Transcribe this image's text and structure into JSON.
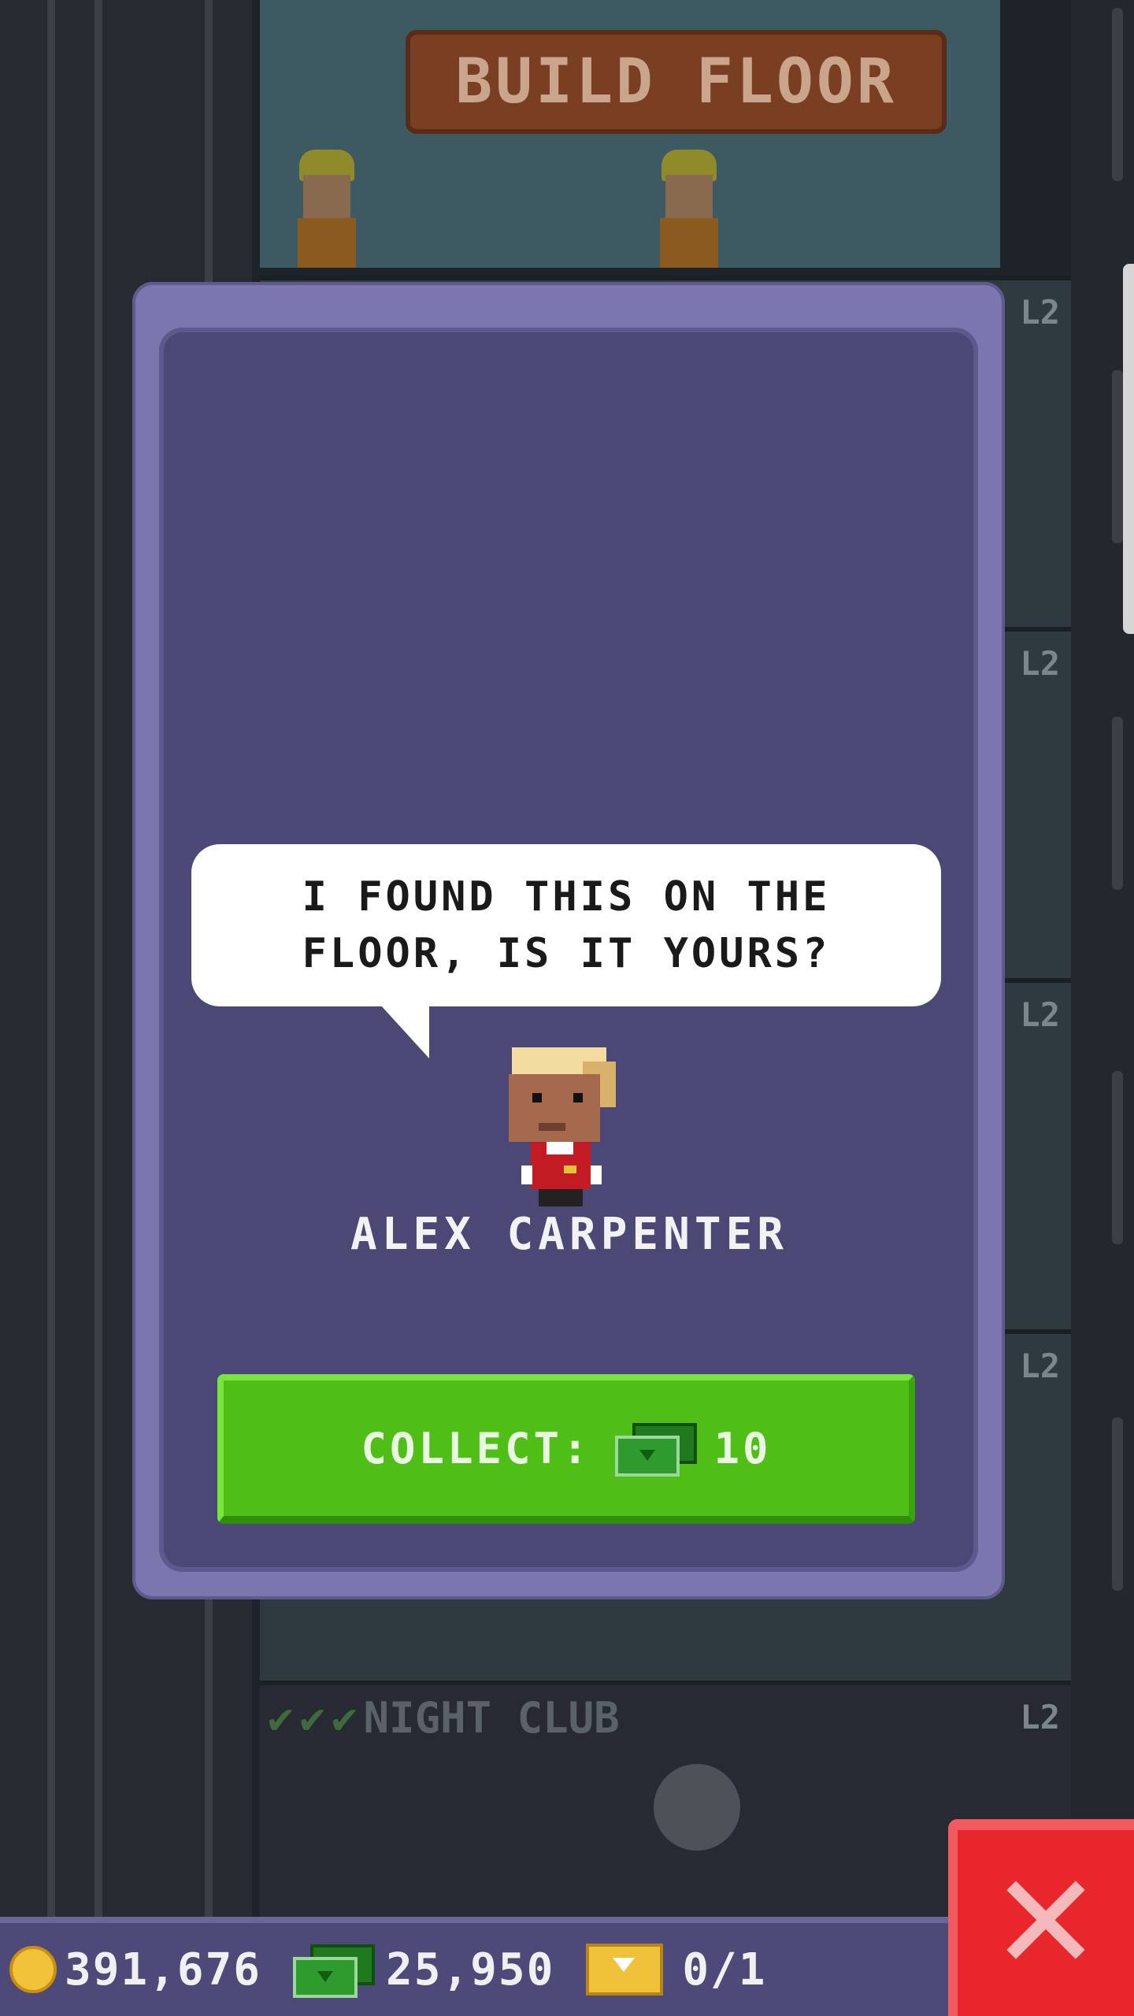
{
  "background": {
    "build_floor_label": "BUILD FLOOR",
    "floor_tag": "L2",
    "night_club_label": "NIGHT CLUB"
  },
  "dialog": {
    "message_line1": "I FOUND THIS ON THE",
    "message_line2": "FLOOR, IS IT YOURS?",
    "character_name": "ALEX CARPENTER",
    "collect_label": "COLLECT:",
    "collect_amount": "10"
  },
  "status_bar": {
    "coins": "391,676",
    "bux": "25,950",
    "tickets": "0/1"
  },
  "colors": {
    "dialog_frame": "#7b77ae",
    "dialog_body": "#4b4876",
    "collect_button": "#4fbf18",
    "close_button": "#e8262c"
  },
  "icons": [
    "coin-icon",
    "bux-icon",
    "ticket-icon",
    "close-icon",
    "checkmark-icon"
  ]
}
